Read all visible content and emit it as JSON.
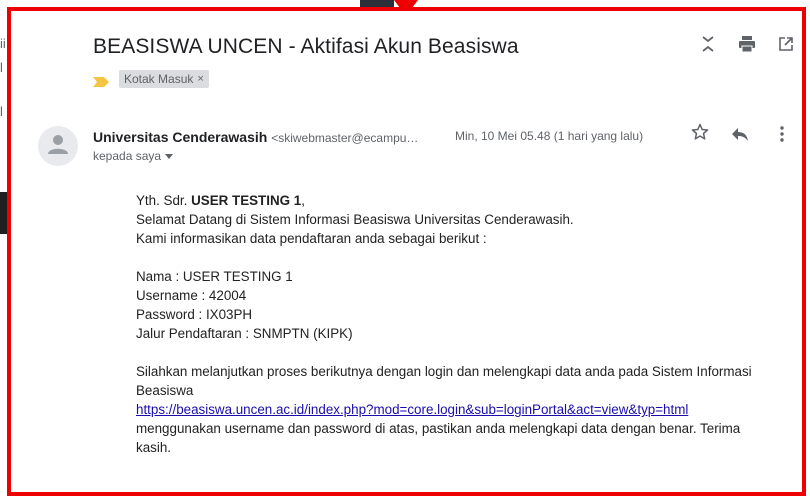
{
  "background": {
    "glyphs": [
      "ii",
      "l",
      "l"
    ]
  },
  "email": {
    "subject": "BEASISWA UNCEN - Aktifasi Akun Beasiswa",
    "label": "Kotak Masuk",
    "label_close": "×",
    "sender_name": "Universitas Cenderawasih",
    "sender_email": "<skiwebmaster@ecampu…",
    "date": "Min, 10 Mei 05.48 (1 hari yang lalu)",
    "recipient": "kepada saya",
    "body": {
      "greeting_prefix": "Yth. Sdr. ",
      "greeting_name": "USER TESTING 1",
      "greeting_suffix": ",",
      "line1": "Selamat Datang di Sistem Informasi Beasiswa Universitas Cenderawasih.",
      "line2": "Kami informasikan data pendaftaran anda sebagai berikut :",
      "nama": "Nama : USER TESTING 1",
      "username": "Username : 42004",
      "password": "Password : IX03PH",
      "jalur": "Jalur Pendaftaran : SNMPTN (KIPK)",
      "instruction": "Silahkan melanjutkan proses berikutnya dengan login dan melengkapi data anda pada Sistem Informasi Beasiswa",
      "link": "https://beasiswa.uncen.ac.id/index.php?mod=core.login&sub=loginPortal&act=view&typ=html",
      "closing": "menggunakan username dan password di atas, pastikan anda melengkapi data dengan benar. Terima kasih."
    }
  },
  "icons": {
    "collapse": "collapse-all-icon",
    "print": "print-icon",
    "new_window": "open-in-new-window-icon",
    "star": "star-icon",
    "reply": "reply-icon",
    "more": "more-vert-icon",
    "avatar": "person-icon",
    "important": "important-marker-icon",
    "dropdown": "caret-down-icon"
  },
  "colors": {
    "highlight_frame": "#ee0000",
    "link": "#1a0dab",
    "important_marker": "#f4c542",
    "label_chip": "#dadce0"
  }
}
